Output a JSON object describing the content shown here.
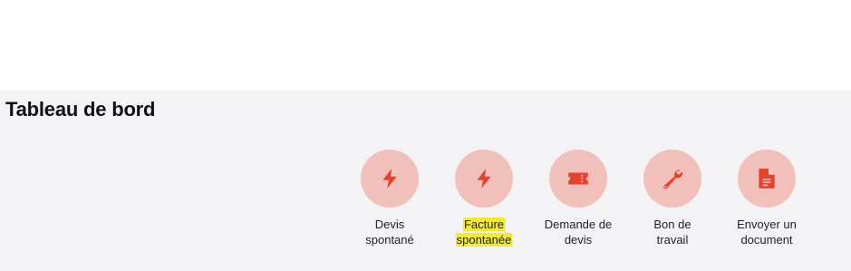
{
  "page": {
    "title": "Tableau de bord"
  },
  "quick_actions": [
    {
      "icon": "lightning-icon",
      "label_lines": [
        "Devis",
        "spontané"
      ]
    },
    {
      "icon": "lightning-icon",
      "label_lines": [
        "Facture",
        "spontanée"
      ],
      "highlighted": true
    },
    {
      "icon": "ticket-icon",
      "label_lines": [
        "Demande de",
        "devis"
      ]
    },
    {
      "icon": "wrench-icon",
      "label_lines": [
        "Bon de",
        "travail"
      ]
    },
    {
      "icon": "document-icon",
      "label_lines": [
        "Envoyer un",
        "document"
      ]
    }
  ],
  "colors": {
    "accent": "#e8412c",
    "icon_circle": "#f2c0bb",
    "highlight": "#f3ea2a",
    "content_background": "#f3f3f6"
  }
}
